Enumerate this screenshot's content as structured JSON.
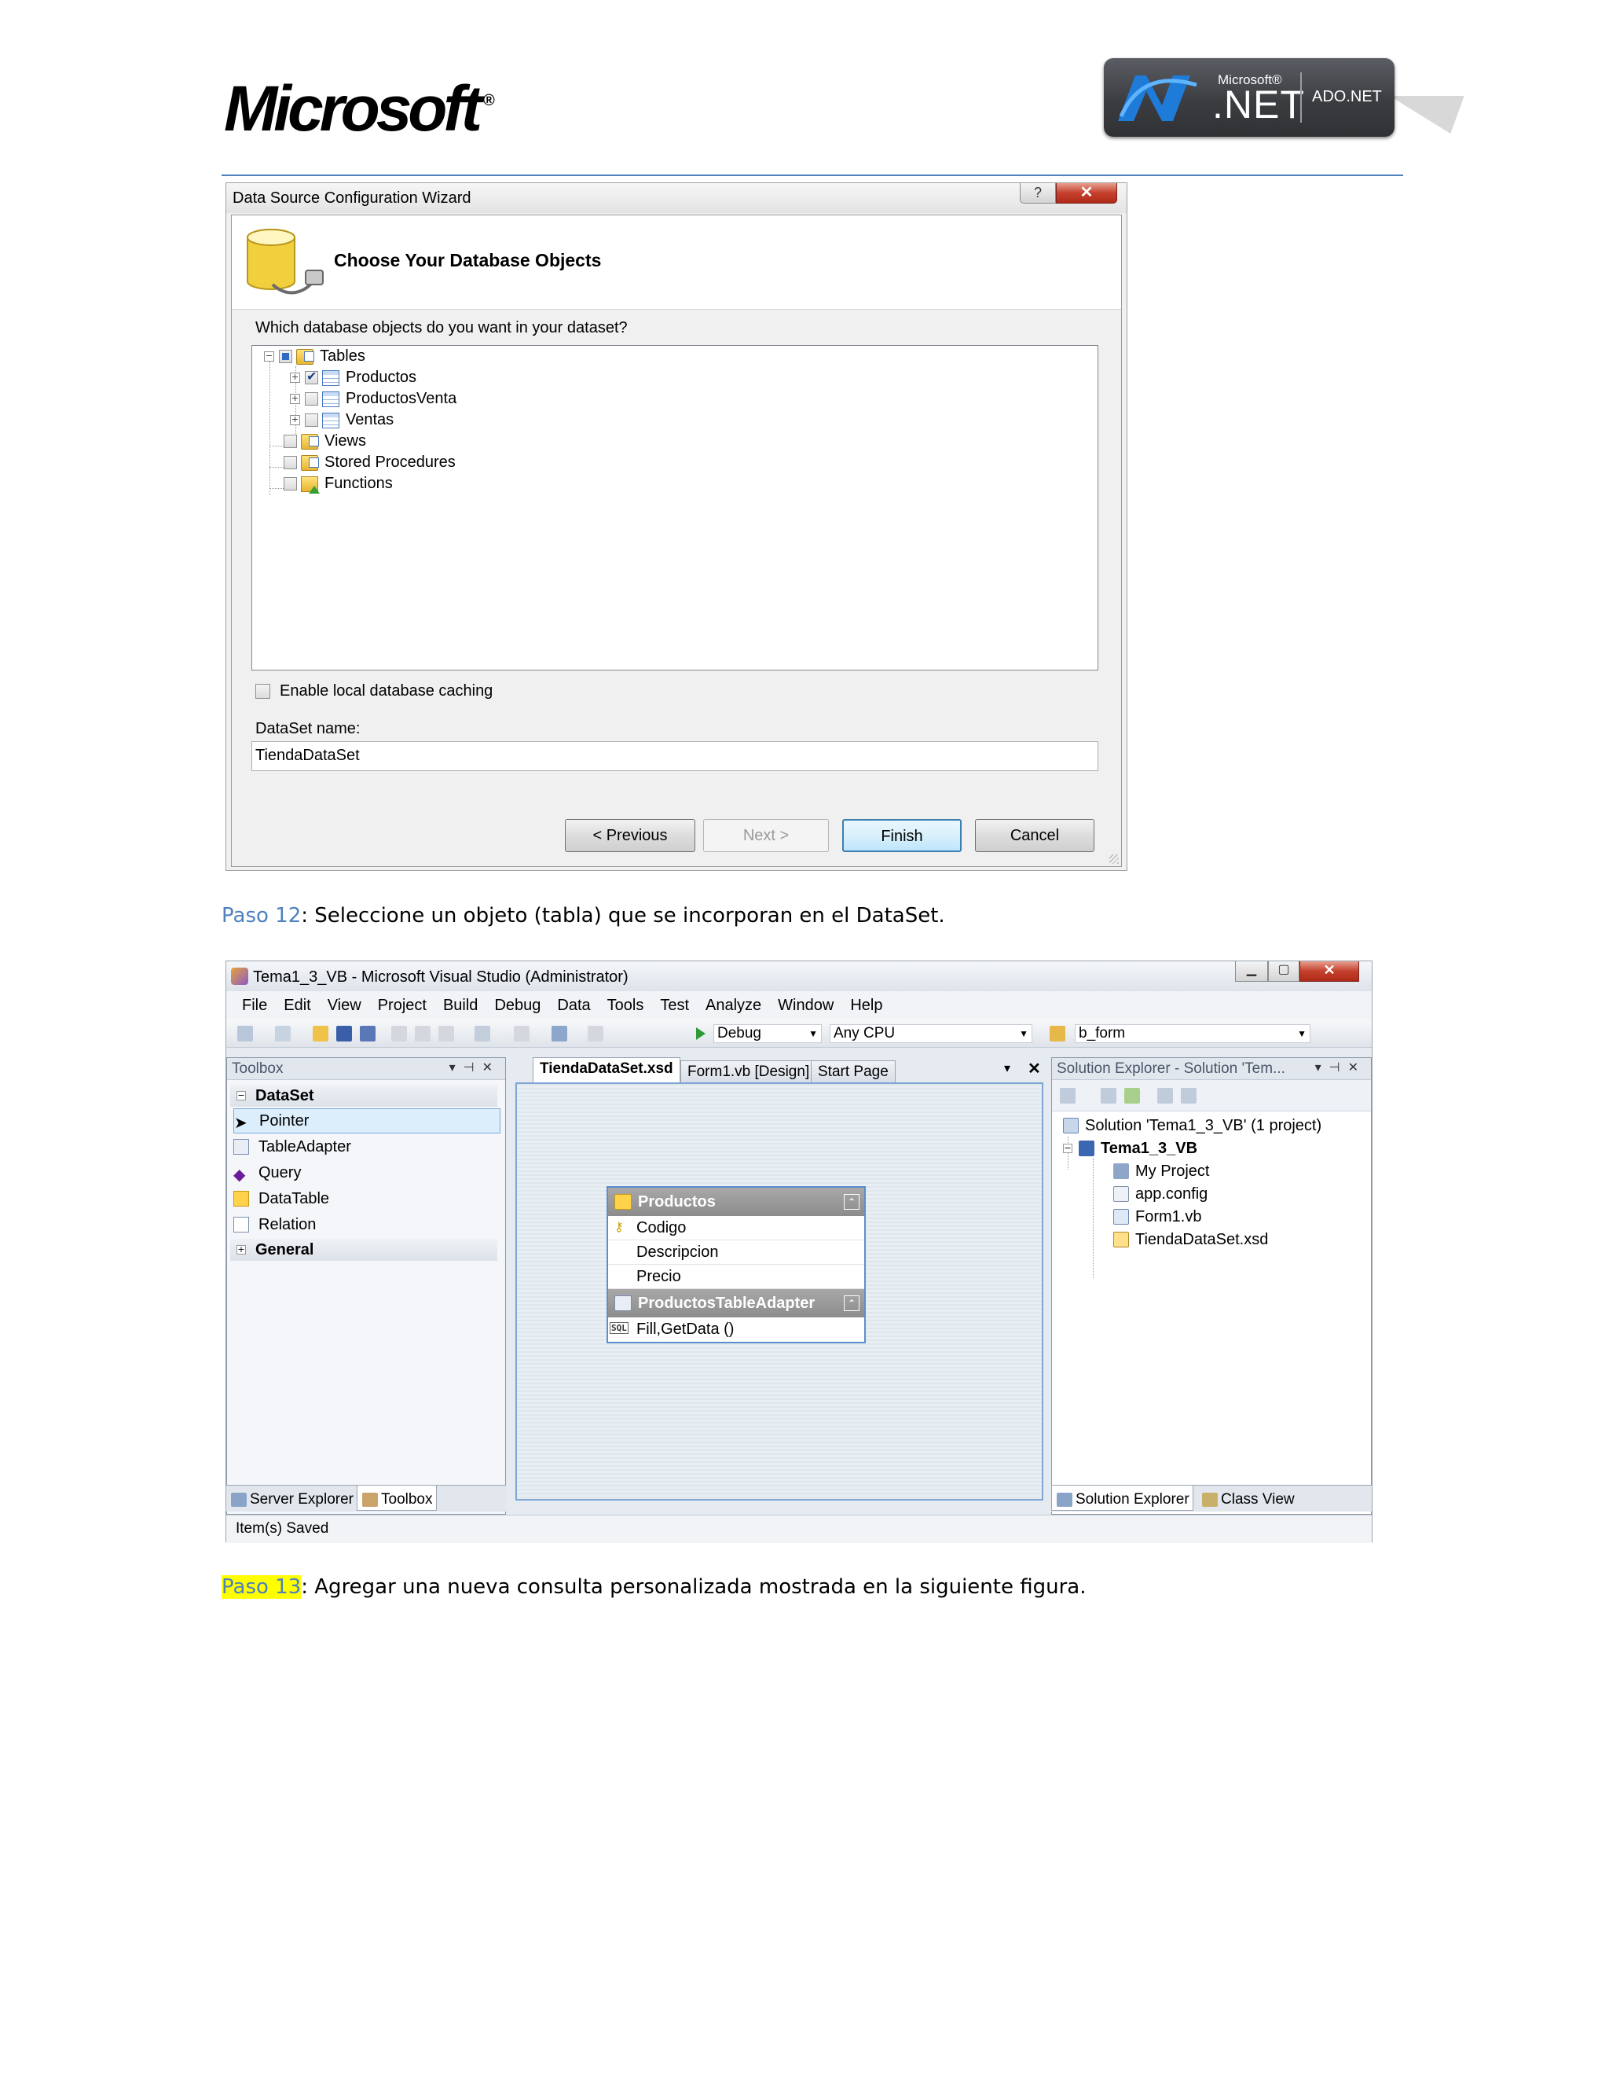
{
  "header": {
    "logo_text": "Microsoft",
    "logo_reg": "®",
    "badge": {
      "brand": "Microsoft®",
      "net": ".NET",
      "product": "ADO.NET"
    }
  },
  "wizard": {
    "title": "Data Source Configuration Wizard",
    "help_glyph": "?",
    "close_glyph": "✕",
    "heading": "Choose Your Database Objects",
    "question": "Which database objects do you want in your dataset?",
    "tree": [
      {
        "label": "Tables",
        "check": "partial",
        "expander": "−",
        "icon": "folder-icon"
      },
      {
        "label": "Productos",
        "check": "checked",
        "expander": "+",
        "icon": "table-icon"
      },
      {
        "label": "ProductosVenta",
        "check": "unchecked",
        "expander": "+",
        "icon": "table-icon"
      },
      {
        "label": "Ventas",
        "check": "unchecked",
        "expander": "+",
        "icon": "table-icon"
      },
      {
        "label": "Views",
        "check": "unchecked",
        "icon": "folder-icon"
      },
      {
        "label": "Stored Procedures",
        "check": "unchecked",
        "icon": "folder-icon"
      },
      {
        "label": "Functions",
        "check": "unchecked",
        "icon": "function-icon"
      }
    ],
    "cache_label": "Enable local database caching",
    "dataset_label": "DataSet name:",
    "dataset_value": "TiendaDataSet",
    "buttons": {
      "previous": "< Previous",
      "next": "Next >",
      "finish": "Finish",
      "cancel": "Cancel"
    }
  },
  "captions": {
    "step12_link": "Paso 12",
    "step12_text": ": Seleccione un objeto (tabla) que se incorporan en el DataSet.",
    "step13_link": "Paso 13",
    "step13_text": ": Agregar una nueva consulta personalizada mostrada en la siguiente figura."
  },
  "vs": {
    "title": "Tema1_3_VB - Microsoft Visual Studio (Administrator)",
    "menu": [
      "File",
      "Edit",
      "View",
      "Project",
      "Build",
      "Debug",
      "Data",
      "Tools",
      "Test",
      "Analyze",
      "Window",
      "Help"
    ],
    "toolbar": {
      "config": "Debug",
      "platform": "Any CPU",
      "find": "b_form"
    },
    "toolbox": {
      "title": "Toolbox",
      "group_dataset": "DataSet",
      "items": [
        "Pointer",
        "TableAdapter",
        "Query",
        "DataTable",
        "Relation"
      ],
      "group_general": "General",
      "tab_server": "Server Explorer",
      "tab_toolbox": "Toolbox"
    },
    "doc_tabs": [
      "TiendaDataSet.xsd",
      "Form1.vb [Design]",
      "Start Page"
    ],
    "entity": {
      "name": "Productos",
      "columns": [
        "Codigo",
        "Descripcion",
        "Precio"
      ],
      "adapter": "ProductosTableAdapter",
      "methods": "Fill,GetData ()"
    },
    "solution": {
      "title": "Solution Explorer - Solution 'Tem...",
      "root": "Solution 'Tema1_3_VB' (1 project)",
      "project": "Tema1_3_VB",
      "items": [
        "My Project",
        "app.config",
        "Form1.vb",
        "TiendaDataSet.xsd"
      ],
      "tab_solution": "Solution Explorer",
      "tab_class": "Class View"
    },
    "status": "Item(s) Saved"
  },
  "colors": {
    "accent": "#4f81bd",
    "highlight": "#ffff00"
  }
}
